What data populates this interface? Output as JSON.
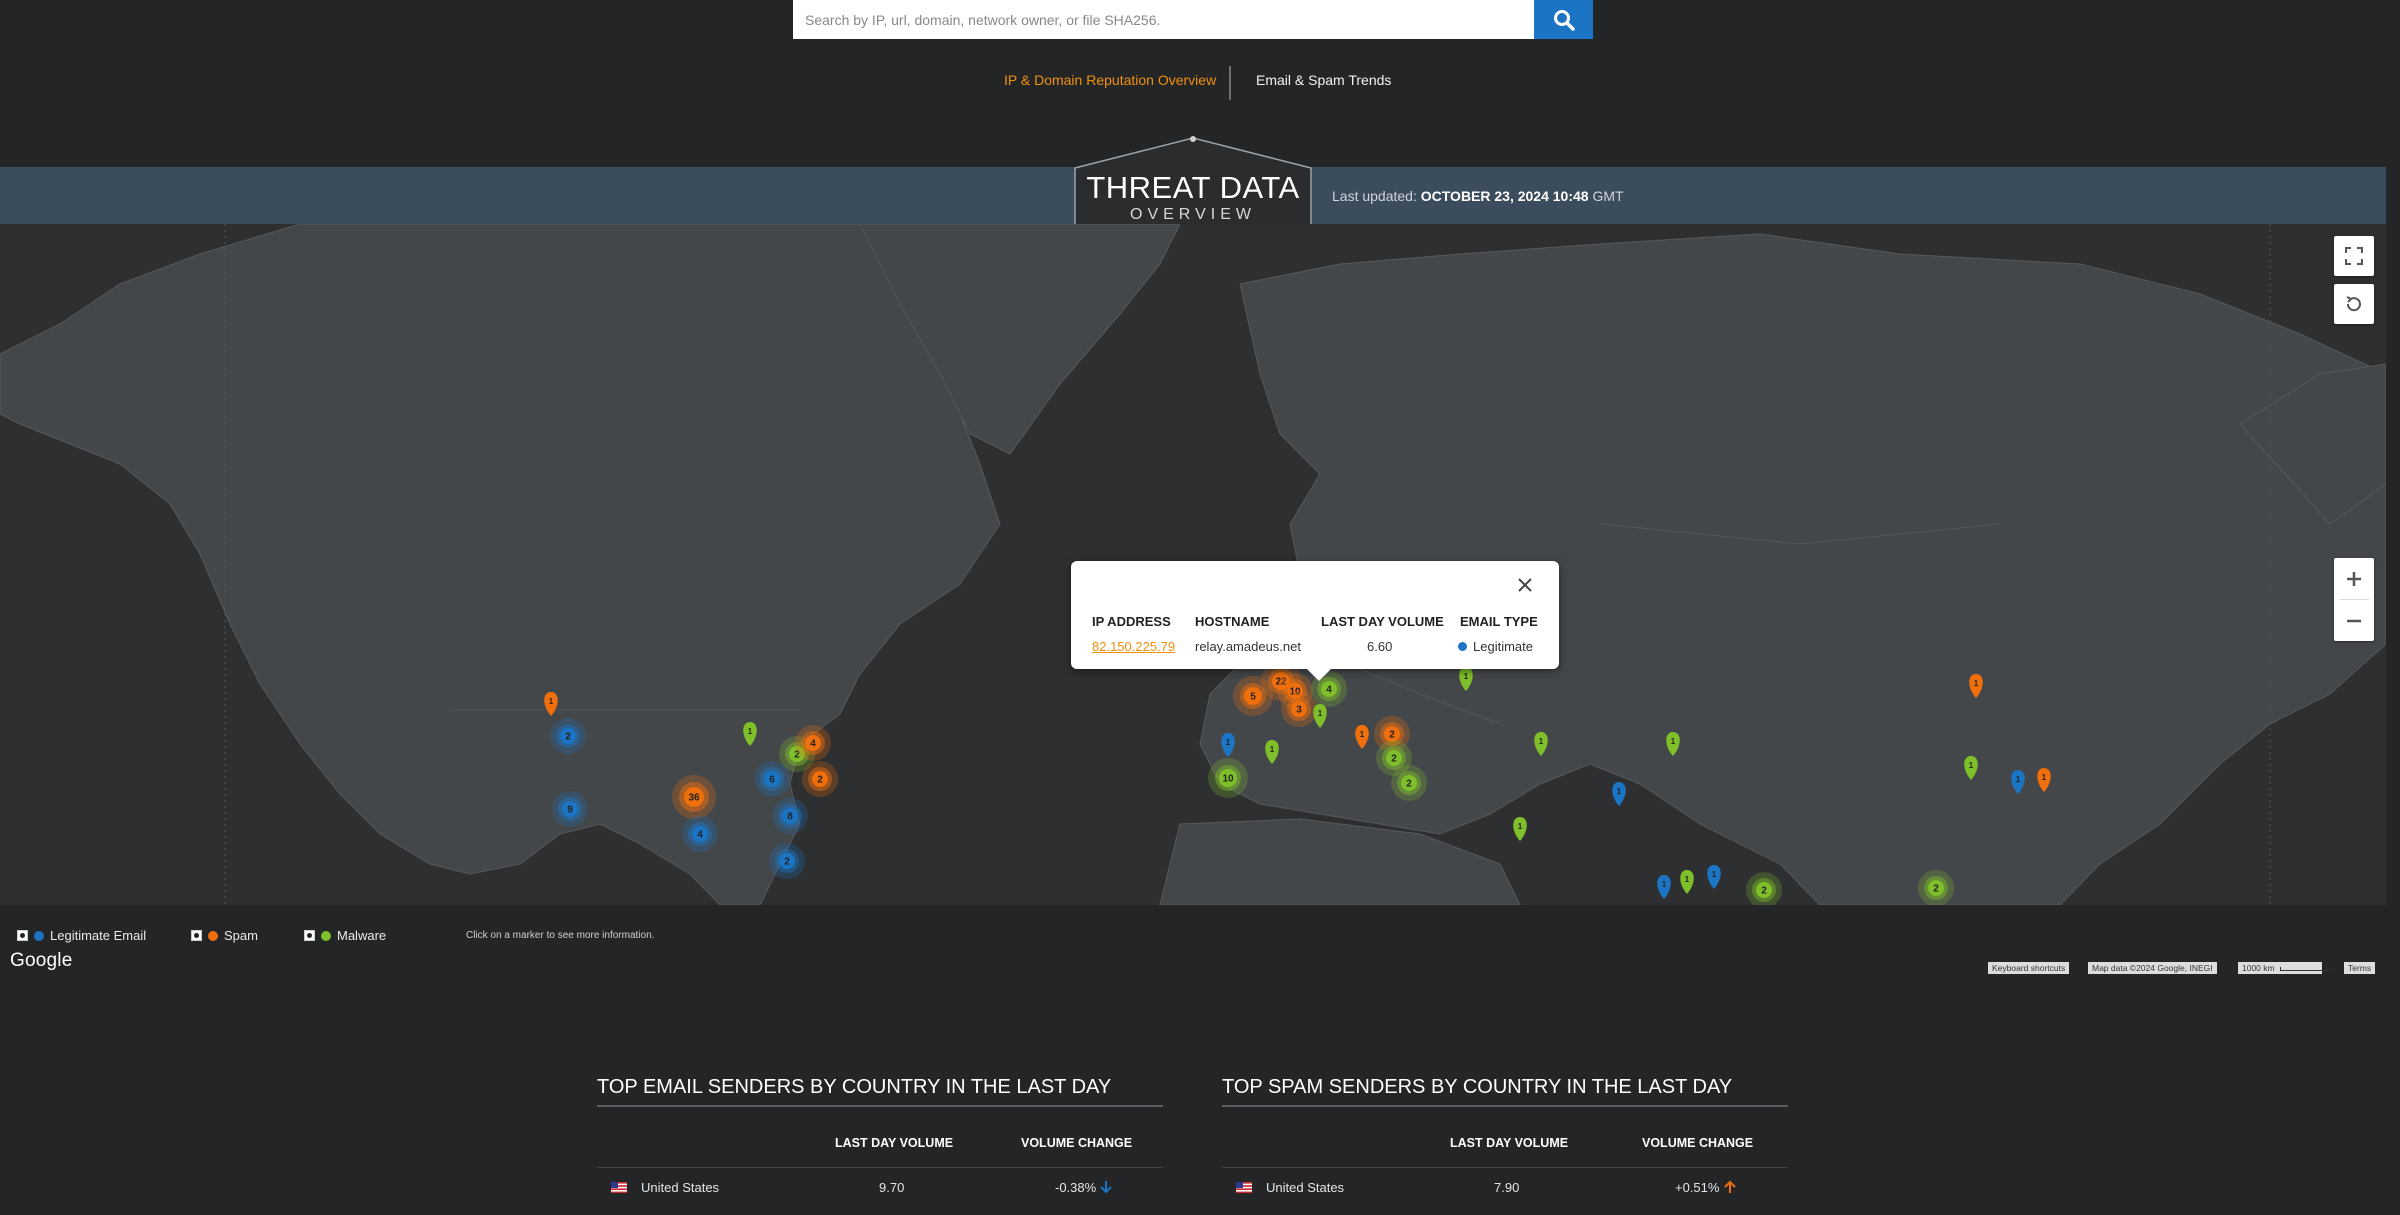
{
  "search": {
    "placeholder": "Search by IP, url, domain, network owner, or file SHA256."
  },
  "tabs": [
    {
      "label": "IP & Domain Reputation Overview",
      "active": true
    },
    {
      "label": "Email & Spam Trends",
      "active": false
    }
  ],
  "header": {
    "title": "THREAT DATA",
    "subtitle": "OVERVIEW",
    "updated_prefix": "Last updated:",
    "updated_value": "OCTOBER 23, 2024 10:48",
    "updated_suffix": "GMT"
  },
  "popup": {
    "headers": [
      "IP ADDRESS",
      "HOSTNAME",
      "LAST DAY VOLUME",
      "EMAIL TYPE"
    ],
    "ip": "82.150.225.79",
    "hostname": "relay.amadeus.net",
    "volume": "6.60",
    "type": "Legitimate"
  },
  "markers": {
    "clusters": [
      {
        "n": "2",
        "kind": "legit",
        "region": "US West"
      },
      {
        "n": "9",
        "kind": "legit",
        "region": "US Southwest"
      },
      {
        "n": "36",
        "kind": "spam",
        "region": "US Central"
      },
      {
        "n": "4",
        "kind": "legit",
        "region": "US South"
      },
      {
        "n": "6",
        "kind": "legit",
        "region": "US Midwest"
      },
      {
        "n": "2",
        "kind": "malware",
        "region": "US Northeast"
      },
      {
        "n": "4",
        "kind": "spam",
        "region": "US Northeast"
      },
      {
        "n": "2",
        "kind": "spam",
        "region": "US East"
      },
      {
        "n": "8",
        "kind": "legit",
        "region": "US Southeast"
      },
      {
        "n": "2",
        "kind": "legit",
        "region": "Florida"
      },
      {
        "n": "5",
        "kind": "spam",
        "region": "France"
      },
      {
        "n": "22",
        "kind": "spam",
        "region": "Benelux"
      },
      {
        "n": "10",
        "kind": "spam",
        "region": "Germany"
      },
      {
        "n": "4",
        "kind": "malware",
        "region": "Central Europe"
      },
      {
        "n": "3",
        "kind": "spam",
        "region": "Switzerland"
      },
      {
        "n": "10",
        "kind": "malware",
        "region": "Spain"
      },
      {
        "n": "2",
        "kind": "spam",
        "region": "Balkans"
      },
      {
        "n": "2",
        "kind": "malware",
        "region": "Balkans"
      },
      {
        "n": "2",
        "kind": "malware",
        "region": "Greece"
      },
      {
        "n": "2",
        "kind": "malware",
        "region": "India"
      },
      {
        "n": "2",
        "kind": "malware",
        "region": "Southeast Asia"
      }
    ],
    "pins": [
      {
        "n": "1",
        "kind": "spam"
      },
      {
        "n": "1",
        "kind": "malware"
      },
      {
        "n": "1",
        "kind": "legit"
      }
    ]
  },
  "legend": {
    "items": [
      {
        "label": "Legitimate Email",
        "color": "#1b75c4"
      },
      {
        "label": "Spam",
        "color": "#f06f0d"
      },
      {
        "label": "Malware",
        "color": "#7fbf2a"
      }
    ],
    "hint": "Click on a marker to see more information."
  },
  "map_footer": {
    "logo": "Google",
    "shortcuts": "Keyboard shortcuts",
    "map_data": "Map data ©2024 Google, INEGI",
    "scale": "1000 km",
    "terms": "Terms"
  },
  "tables": [
    {
      "title": "TOP EMAIL SENDERS BY COUNTRY IN THE LAST DAY",
      "col_volume": "LAST DAY VOLUME",
      "col_change": "VOLUME CHANGE",
      "rows": [
        {
          "country": "United States",
          "volume": "9.70",
          "change": "-0.38%",
          "direction": "down"
        }
      ]
    },
    {
      "title": "TOP SPAM SENDERS BY COUNTRY IN THE LAST DAY",
      "col_volume": "LAST DAY VOLUME",
      "col_change": "VOLUME CHANGE",
      "rows": [
        {
          "country": "United States",
          "volume": "7.90",
          "change": "+0.51%",
          "direction": "up"
        }
      ]
    }
  ],
  "colors": {
    "accent": "#f0900d",
    "legit": "#1b75c4",
    "spam": "#f06f0d",
    "malware": "#7fbf2a",
    "band": "#3b4c5c"
  }
}
